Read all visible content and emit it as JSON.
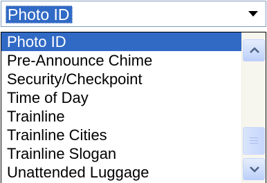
{
  "combo": {
    "selected_value": "Photo ID",
    "button_icon": "chevron-down-icon"
  },
  "dropdown": {
    "items": [
      {
        "label": "Photo ID",
        "selected": true
      },
      {
        "label": "Pre-Announce Chime",
        "selected": false
      },
      {
        "label": "Security/Checkpoint",
        "selected": false
      },
      {
        "label": "Time of Day",
        "selected": false
      },
      {
        "label": "Trainline",
        "selected": false
      },
      {
        "label": "Trainline Cities",
        "selected": false
      },
      {
        "label": "Trainline Slogan",
        "selected": false
      },
      {
        "label": "Unattended Luggage",
        "selected": false
      }
    ],
    "scroll_up_icon": "chevron-up-icon",
    "scroll_down_icon": "chevron-down-icon"
  },
  "colors": {
    "selection": "#316ac5",
    "border": "#7f9db9"
  }
}
